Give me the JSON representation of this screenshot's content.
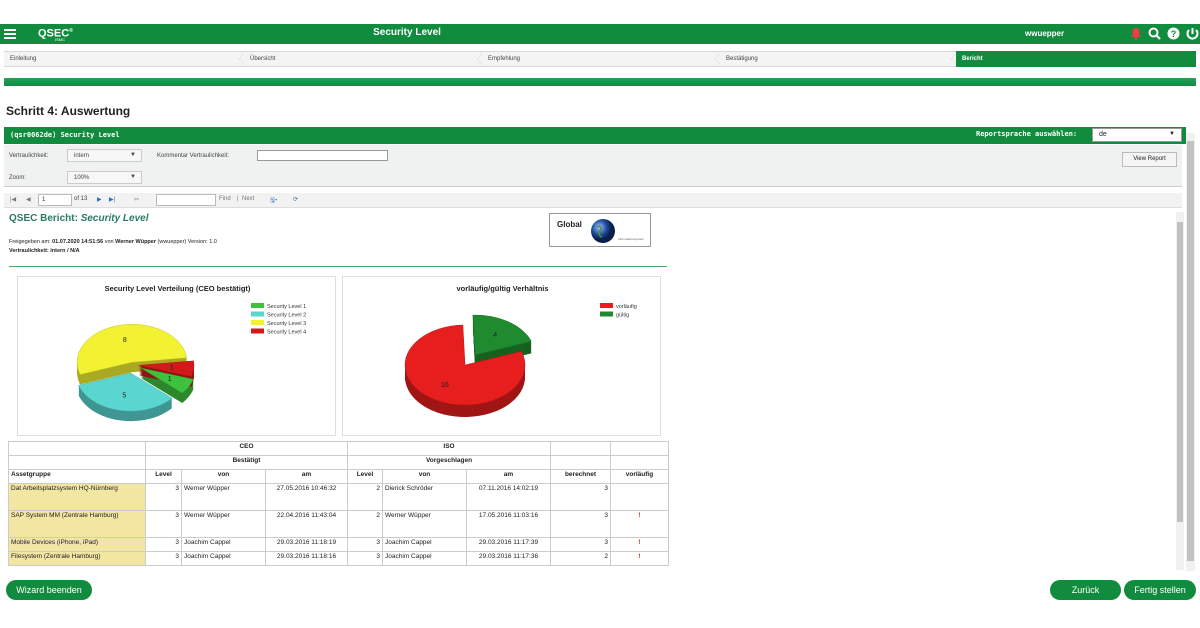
{
  "app": {
    "logo": "QSEC",
    "logo_mark": "®",
    "logo_sub": "ISMC",
    "title": "Security Level",
    "username": "wwuepper"
  },
  "top_icons": [
    "bell-icon",
    "search-icon",
    "help-icon",
    "logout-icon"
  ],
  "colors": {
    "brand_green": "#118c3f",
    "asset_highlight": "#f2e6a2",
    "alert_red": "#e0242a"
  },
  "steps": [
    {
      "label": "Einleitung"
    },
    {
      "label": "Übersicht"
    },
    {
      "label": "Empfehlung"
    },
    {
      "label": "Bestätigung"
    },
    {
      "label": "Bericht",
      "active": true
    }
  ],
  "page_title": "Schritt 4: Auswertung",
  "report_header": {
    "title": "(qsr0062de) Security Level",
    "lang_label": "Reportsprache auswählen:",
    "lang_value": "de"
  },
  "params": {
    "confidentiality_label": "Vertraulichkeit:",
    "confidentiality_value": "intern",
    "comment_label": "Kommentar Vertraulichkeit:",
    "comment_value": "",
    "zoom_label": "Zoom:",
    "zoom_value": "100%",
    "view_report": "View Report"
  },
  "toolbar": {
    "page": "1",
    "of_pages": "of 13",
    "find": "Find",
    "separator": "|",
    "next": "Next"
  },
  "report": {
    "title_prefix": "QSEC Bericht:",
    "title_name": "Security Level",
    "meta_line1_prefix": "Freigegeben am:",
    "meta_date": "01.07.2020 14:51:56",
    "meta_von": "von",
    "meta_user": "Werner Wüpper",
    "meta_user_detail": "(wwuepper) Version: 1.0",
    "meta_line2": "Vertraulichkeit: intern / N/A",
    "logo_text": "Global",
    "logo_small": "Informationssystem"
  },
  "chart_data": [
    {
      "type": "pie",
      "title": "Security Level Verteilung (CEO bestätigt)",
      "categories": [
        "Security Level 1",
        "Security Level 2",
        "Security Level 3",
        "Security Level 4"
      ],
      "values": [
        1,
        5,
        8,
        1
      ],
      "colors": [
        "#3ec23e",
        "#5ad6d0",
        "#f2f232",
        "#d21a1a"
      ],
      "legend": "top-right"
    },
    {
      "type": "pie",
      "title": "vorläufig/gültig Verhältnis",
      "categories": [
        "vorläufig",
        "gültig"
      ],
      "values": [
        16,
        4
      ],
      "colors": [
        "#e61e1e",
        "#1f8a2e"
      ],
      "legend": "top-right"
    }
  ],
  "table": {
    "group_ceo": "CEO",
    "group_iso": "ISO",
    "sub_ceo": "Bestätigt",
    "sub_iso": "Vorgeschlagen",
    "columns": [
      "Assetgruppe",
      "Level",
      "von",
      "am",
      "Level",
      "von",
      "am",
      "berechnet",
      "vorläufig"
    ],
    "rows": [
      {
        "asset": "Dat Arbeitsplatzsystem HQ-Nürnberg",
        "ceo_level": "3",
        "ceo_von": "Werner Wüpper",
        "ceo_am": "27.05.2016 10:46:32",
        "iso_level": "2",
        "iso_von": "Dierick Schröder",
        "iso_am": "07.11.2016 14:02:19",
        "berechnet": "3",
        "vorlaeufig": ""
      },
      {
        "asset": "SAP System MM (Zentrale Hamburg)",
        "ceo_level": "3",
        "ceo_von": "Werner Wüpper",
        "ceo_am": "22.04.2016 11:43:04",
        "iso_level": "2",
        "iso_von": "Werner Wüpper",
        "iso_am": "17.05.2016 11:03:16",
        "berechnet": "3",
        "vorlaeufig": "!"
      },
      {
        "asset": "Mobile Devices (iPhone, iPad)",
        "ceo_level": "3",
        "ceo_von": "Joachim Cappel",
        "ceo_am": "29.03.2016 11:18:19",
        "iso_level": "3",
        "iso_von": "Joachim Cappel",
        "iso_am": "29.03.2016 11:17:39",
        "berechnet": "3",
        "vorlaeufig": "!"
      },
      {
        "asset": "Filesystem (Zentrale Hamburg)",
        "ceo_level": "3",
        "ceo_von": "Joachim Cappel",
        "ceo_am": "29.03.2016 11:18:16",
        "iso_level": "3",
        "iso_von": "Joachim Cappel",
        "iso_am": "29.03.2016 11:17:36",
        "berechnet": "2",
        "vorlaeufig": "!"
      }
    ]
  },
  "buttons": {
    "finish_wizard": "Wizard beenden",
    "back": "Zurück",
    "done": "Fertig stellen"
  }
}
